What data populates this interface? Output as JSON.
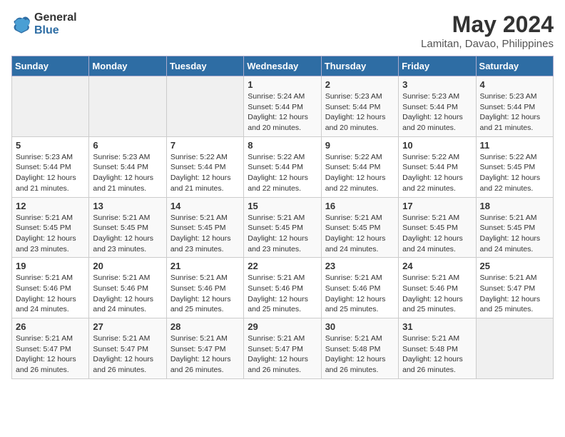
{
  "header": {
    "logo_line1": "General",
    "logo_line2": "Blue",
    "title": "May 2024",
    "location": "Lamitan, Davao, Philippines"
  },
  "weekdays": [
    "Sunday",
    "Monday",
    "Tuesday",
    "Wednesday",
    "Thursday",
    "Friday",
    "Saturday"
  ],
  "weeks": [
    [
      {
        "day": "",
        "sunrise": "",
        "sunset": "",
        "daylight": ""
      },
      {
        "day": "",
        "sunrise": "",
        "sunset": "",
        "daylight": ""
      },
      {
        "day": "",
        "sunrise": "",
        "sunset": "",
        "daylight": ""
      },
      {
        "day": "1",
        "sunrise": "Sunrise: 5:24 AM",
        "sunset": "Sunset: 5:44 PM",
        "daylight": "Daylight: 12 hours and 20 minutes."
      },
      {
        "day": "2",
        "sunrise": "Sunrise: 5:23 AM",
        "sunset": "Sunset: 5:44 PM",
        "daylight": "Daylight: 12 hours and 20 minutes."
      },
      {
        "day": "3",
        "sunrise": "Sunrise: 5:23 AM",
        "sunset": "Sunset: 5:44 PM",
        "daylight": "Daylight: 12 hours and 20 minutes."
      },
      {
        "day": "4",
        "sunrise": "Sunrise: 5:23 AM",
        "sunset": "Sunset: 5:44 PM",
        "daylight": "Daylight: 12 hours and 21 minutes."
      }
    ],
    [
      {
        "day": "5",
        "sunrise": "Sunrise: 5:23 AM",
        "sunset": "Sunset: 5:44 PM",
        "daylight": "Daylight: 12 hours and 21 minutes."
      },
      {
        "day": "6",
        "sunrise": "Sunrise: 5:23 AM",
        "sunset": "Sunset: 5:44 PM",
        "daylight": "Daylight: 12 hours and 21 minutes."
      },
      {
        "day": "7",
        "sunrise": "Sunrise: 5:22 AM",
        "sunset": "Sunset: 5:44 PM",
        "daylight": "Daylight: 12 hours and 21 minutes."
      },
      {
        "day": "8",
        "sunrise": "Sunrise: 5:22 AM",
        "sunset": "Sunset: 5:44 PM",
        "daylight": "Daylight: 12 hours and 22 minutes."
      },
      {
        "day": "9",
        "sunrise": "Sunrise: 5:22 AM",
        "sunset": "Sunset: 5:44 PM",
        "daylight": "Daylight: 12 hours and 22 minutes."
      },
      {
        "day": "10",
        "sunrise": "Sunrise: 5:22 AM",
        "sunset": "Sunset: 5:44 PM",
        "daylight": "Daylight: 12 hours and 22 minutes."
      },
      {
        "day": "11",
        "sunrise": "Sunrise: 5:22 AM",
        "sunset": "Sunset: 5:45 PM",
        "daylight": "Daylight: 12 hours and 22 minutes."
      }
    ],
    [
      {
        "day": "12",
        "sunrise": "Sunrise: 5:21 AM",
        "sunset": "Sunset: 5:45 PM",
        "daylight": "Daylight: 12 hours and 23 minutes."
      },
      {
        "day": "13",
        "sunrise": "Sunrise: 5:21 AM",
        "sunset": "Sunset: 5:45 PM",
        "daylight": "Daylight: 12 hours and 23 minutes."
      },
      {
        "day": "14",
        "sunrise": "Sunrise: 5:21 AM",
        "sunset": "Sunset: 5:45 PM",
        "daylight": "Daylight: 12 hours and 23 minutes."
      },
      {
        "day": "15",
        "sunrise": "Sunrise: 5:21 AM",
        "sunset": "Sunset: 5:45 PM",
        "daylight": "Daylight: 12 hours and 23 minutes."
      },
      {
        "day": "16",
        "sunrise": "Sunrise: 5:21 AM",
        "sunset": "Sunset: 5:45 PM",
        "daylight": "Daylight: 12 hours and 24 minutes."
      },
      {
        "day": "17",
        "sunrise": "Sunrise: 5:21 AM",
        "sunset": "Sunset: 5:45 PM",
        "daylight": "Daylight: 12 hours and 24 minutes."
      },
      {
        "day": "18",
        "sunrise": "Sunrise: 5:21 AM",
        "sunset": "Sunset: 5:45 PM",
        "daylight": "Daylight: 12 hours and 24 minutes."
      }
    ],
    [
      {
        "day": "19",
        "sunrise": "Sunrise: 5:21 AM",
        "sunset": "Sunset: 5:46 PM",
        "daylight": "Daylight: 12 hours and 24 minutes."
      },
      {
        "day": "20",
        "sunrise": "Sunrise: 5:21 AM",
        "sunset": "Sunset: 5:46 PM",
        "daylight": "Daylight: 12 hours and 24 minutes."
      },
      {
        "day": "21",
        "sunrise": "Sunrise: 5:21 AM",
        "sunset": "Sunset: 5:46 PM",
        "daylight": "Daylight: 12 hours and 25 minutes."
      },
      {
        "day": "22",
        "sunrise": "Sunrise: 5:21 AM",
        "sunset": "Sunset: 5:46 PM",
        "daylight": "Daylight: 12 hours and 25 minutes."
      },
      {
        "day": "23",
        "sunrise": "Sunrise: 5:21 AM",
        "sunset": "Sunset: 5:46 PM",
        "daylight": "Daylight: 12 hours and 25 minutes."
      },
      {
        "day": "24",
        "sunrise": "Sunrise: 5:21 AM",
        "sunset": "Sunset: 5:46 PM",
        "daylight": "Daylight: 12 hours and 25 minutes."
      },
      {
        "day": "25",
        "sunrise": "Sunrise: 5:21 AM",
        "sunset": "Sunset: 5:47 PM",
        "daylight": "Daylight: 12 hours and 25 minutes."
      }
    ],
    [
      {
        "day": "26",
        "sunrise": "Sunrise: 5:21 AM",
        "sunset": "Sunset: 5:47 PM",
        "daylight": "Daylight: 12 hours and 26 minutes."
      },
      {
        "day": "27",
        "sunrise": "Sunrise: 5:21 AM",
        "sunset": "Sunset: 5:47 PM",
        "daylight": "Daylight: 12 hours and 26 minutes."
      },
      {
        "day": "28",
        "sunrise": "Sunrise: 5:21 AM",
        "sunset": "Sunset: 5:47 PM",
        "daylight": "Daylight: 12 hours and 26 minutes."
      },
      {
        "day": "29",
        "sunrise": "Sunrise: 5:21 AM",
        "sunset": "Sunset: 5:47 PM",
        "daylight": "Daylight: 12 hours and 26 minutes."
      },
      {
        "day": "30",
        "sunrise": "Sunrise: 5:21 AM",
        "sunset": "Sunset: 5:48 PM",
        "daylight": "Daylight: 12 hours and 26 minutes."
      },
      {
        "day": "31",
        "sunrise": "Sunrise: 5:21 AM",
        "sunset": "Sunset: 5:48 PM",
        "daylight": "Daylight: 12 hours and 26 minutes."
      },
      {
        "day": "",
        "sunrise": "",
        "sunset": "",
        "daylight": ""
      }
    ]
  ]
}
